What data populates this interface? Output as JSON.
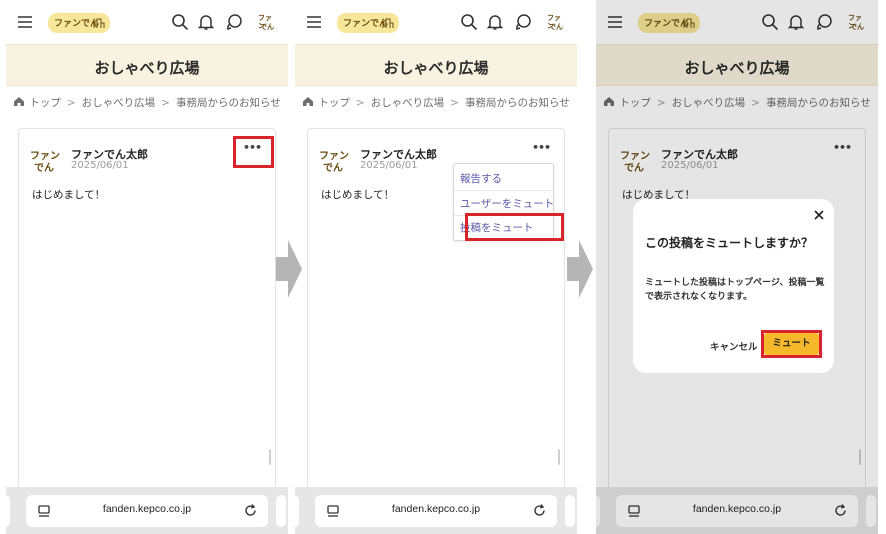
{
  "colors": {
    "highlight_red": "#d8242b",
    "mute_button_yellow": "#f5b82a",
    "title_band": "#f8f2e0",
    "menu_link": "#5a57a8",
    "logo_yellow": "#f7e79a"
  },
  "app": {
    "logo_text": "ファンでん",
    "avatar_text_top": "ファン",
    "avatar_text_bottom": "でん"
  },
  "page": {
    "title": "おしゃべり広場"
  },
  "breadcrumb": [
    "トップ",
    "おしゃべり広場",
    "事務局からのお知らせ"
  ],
  "breadcrumb_separator": ">",
  "post": {
    "author": "ファンでん太郎",
    "date": "2025/06/01",
    "body": "はじめまして！",
    "more_label": "•••"
  },
  "menu": {
    "items": [
      "報告する",
      "ユーザーをミュート",
      "投稿をミュート"
    ]
  },
  "dialog": {
    "close_label": "×",
    "title": "この投稿をミュートしますか？",
    "message": "ミュートした投稿はトップページ、投稿一覧で表示されなくなります。",
    "cancel_label": "キャンセル",
    "confirm_label": "ミュート"
  },
  "browser": {
    "url": "fanden.kepco.co.jp"
  },
  "icons": [
    "hamburger-menu-icon",
    "search-icon",
    "bell-icon",
    "chat-icon",
    "home-icon",
    "tabs-icon",
    "reload-icon",
    "close-icon",
    "step-arrow-icon"
  ]
}
